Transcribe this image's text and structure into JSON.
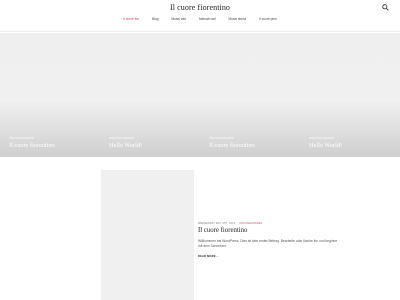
{
  "header": {
    "site_title": "Il cuore fiorentino",
    "search_icon": "search-icon"
  },
  "nav": {
    "items": [
      {
        "label": "Il cuore fior",
        "active": true
      },
      {
        "label": "Blog",
        "active": false
      },
      {
        "label": "Musei vari",
        "active": false
      },
      {
        "label": "Mercati vari",
        "active": false
      },
      {
        "label": "Musei storici",
        "active": false
      },
      {
        "label": "Il cuore pien",
        "active": false
      }
    ],
    "active_color": "#d0465e"
  },
  "slider": {
    "slides": [
      {
        "category": "UNCATEGORIZED",
        "title": "Il cuore fiorentino"
      },
      {
        "category": "UNCATEGORIZED",
        "title": "Hello World!"
      },
      {
        "category": "UNCATEGORIZED",
        "title": "Il cuore fiorentino"
      },
      {
        "category": "UNCATEGORIZED",
        "title": "Hello World!"
      }
    ]
  },
  "post": {
    "date": "WEDNESDAY MAY 4TH, 2022",
    "category": "UNCATEGORIZED",
    "title": "Il cuore fiorentino",
    "excerpt": "Willkommen bei WordPress. Dies ist dein erster Beitrag. Bearbeite oder lösche ihn und beginne mit dem Schreiben!",
    "read_more": "READ MORE"
  }
}
